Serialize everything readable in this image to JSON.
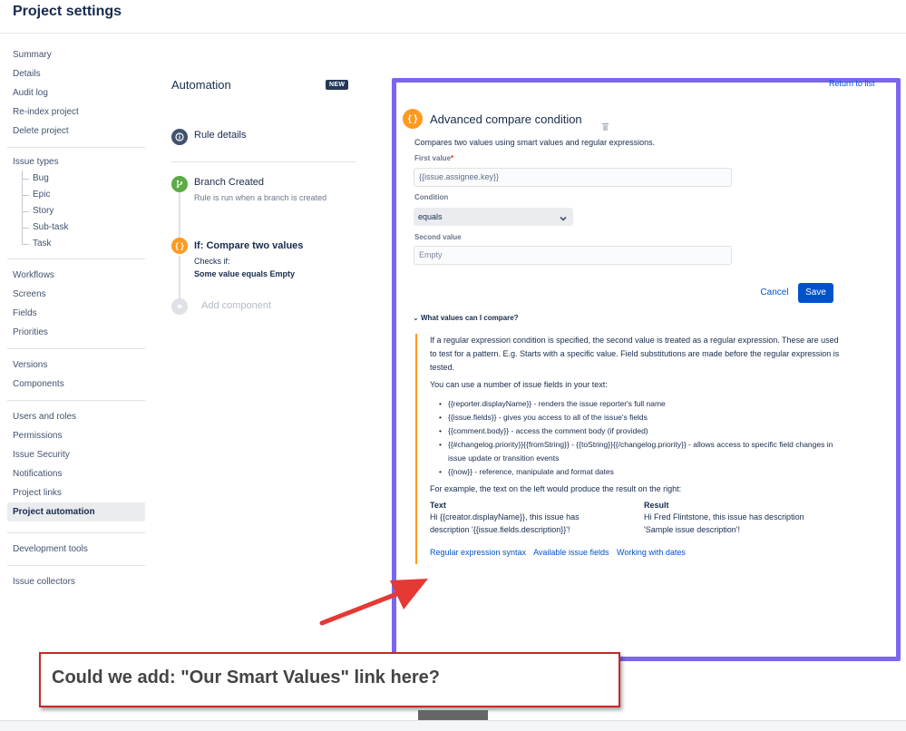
{
  "header": {
    "title": "Project settings"
  },
  "sidebar": {
    "group1": [
      "Summary",
      "Details",
      "Audit log",
      "Re-index project",
      "Delete project"
    ],
    "issue_types": {
      "label": "Issue types",
      "items": [
        "Bug",
        "Epic",
        "Story",
        "Sub-task",
        "Task"
      ]
    },
    "group3": [
      "Workflows",
      "Screens",
      "Fields",
      "Priorities"
    ],
    "group4": [
      "Versions",
      "Components"
    ],
    "group5": [
      "Users and roles",
      "Permissions",
      "Issue Security",
      "Notifications",
      "Project links",
      "Project automation"
    ],
    "group6": [
      "Development tools"
    ],
    "group7": [
      "Issue collectors"
    ],
    "active": "Project automation"
  },
  "automation": {
    "title": "Automation",
    "badge": "NEW",
    "rule_details": "Rule details",
    "branch_title": "Branch Created",
    "branch_sub": "Rule is run when a branch is created",
    "if_title": "If: Compare two values",
    "if_checks": "Checks if:",
    "if_detail": "Some value equals Empty",
    "add_component": "Add component"
  },
  "panel": {
    "return_link": "Return to list",
    "title": "Advanced compare condition",
    "description": "Compares two values using smart values and regular expressions.",
    "first_value_label": "First value",
    "first_value": "{{issue.assignee.key}}",
    "condition_label": "Condition",
    "condition_value": "equals",
    "second_value_label": "Second value",
    "second_value_placeholder": "Empty",
    "cancel": "Cancel",
    "save": "Save",
    "expander": "What values can I compare?",
    "help_p1": "If a regular expression condition is specified, the second value is treated as a regular expression. These are used to test for a pattern. E.g. Starts with a specific value. Field substitutions are made before the regular expression is tested.",
    "help_p2": "You can use a number of issue fields in your text:",
    "help_items": [
      "{{reporter.displayName}} - renders the issue reporter's full name",
      "{{issue.fields}} - gives you access to all of the issue's fields",
      "{{comment.body}} - access the comment body (if provided)",
      "{{#changelog.priority}}{{fromString}} - {{toString}}{{/changelog.priority}} - allows access to specific field changes in issue update or transition events",
      "{{now}} - reference, manipulate and format dates"
    ],
    "help_p3": "For example, the text on the left would produce the result on the right:",
    "text_head": "Text",
    "text_value": "Hi {{creator.displayName}}, this issue has description '{{issue.fields.description}}'!",
    "result_head": "Result",
    "result_value": "Hi Fred Flintstone, this issue has description 'Sample issue description'!",
    "links": [
      "Regular expression syntax",
      "Available issue fields",
      "Working with dates"
    ]
  },
  "callout": {
    "text": "Could we add: \"Our Smart Values\" link here?"
  },
  "colors": {
    "highlight": "#7b66f2",
    "arrow": "#e53935",
    "primary": "#0052cc",
    "accent_orange": "#ff991f",
    "branch_green": "#5aac44"
  },
  "icons": [
    "info-icon",
    "branch-icon",
    "curly-braces-icon",
    "plus-icon",
    "trash-icon",
    "chevron-down-icon"
  ]
}
